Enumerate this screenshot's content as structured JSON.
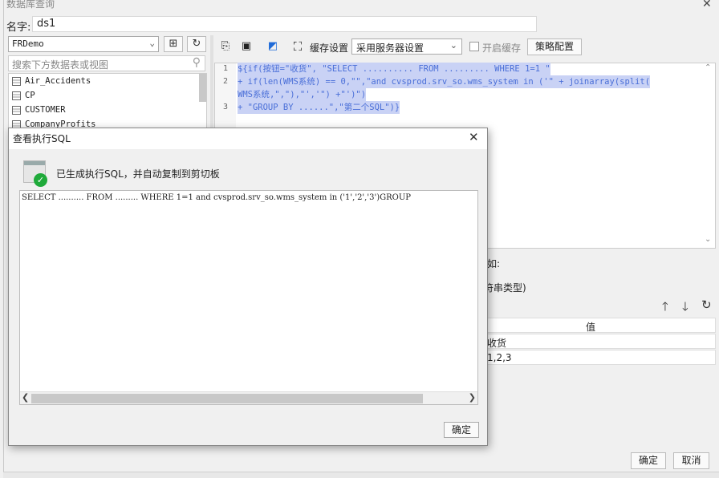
{
  "window": {
    "title": "数据库查询",
    "close_glyph": "✕"
  },
  "name_field": {
    "label": "名字:",
    "value": "ds1"
  },
  "datasource": {
    "selected": "FRDemo"
  },
  "search": {
    "placeholder": "搜索下方数据表或视图"
  },
  "tables": [
    "Air_Accidents",
    "CP",
    "CUSTOMER",
    "CompanyProfits"
  ],
  "toolbar": {
    "cache_label": "缓存设置",
    "cache_select": "采用服务器设置",
    "enable_cache_label": "开启缓存",
    "policy_button": "策略配置"
  },
  "editor": {
    "line_numbers": [
      "1",
      "2",
      "3"
    ],
    "lines": [
      "${if(按钮=\"收货\", \"SELECT .......... FROM ......... WHERE 1=1 \"",
      "+ if(len(WMS系统) == 0,\"\",\"and cvsprod.srv_so.wms_system in ('\" + joinarray(split(",
      "WMS系统,\",\"),\"','\") +\"')\")",
      "+ \"GROUP BY ......\",\"第二个SQL\")}"
    ]
  },
  "params": {
    "hint_fragment": "如:",
    "type_fragment": "符串类型)",
    "value_header": "值",
    "rows": [
      "收货",
      "1,2,3"
    ]
  },
  "footer": {
    "ok": "确定",
    "cancel": "取消"
  },
  "dialog": {
    "title": "查看执行SQL",
    "message": "已生成执行SQL，并自动复制到剪切板",
    "sql": "SELECT .......... FROM ......... WHERE 1=1 and cvsprod.srv_so.wms_system in ('1','2','3')GROUP",
    "ok": "确定",
    "close_glyph": "✕"
  }
}
